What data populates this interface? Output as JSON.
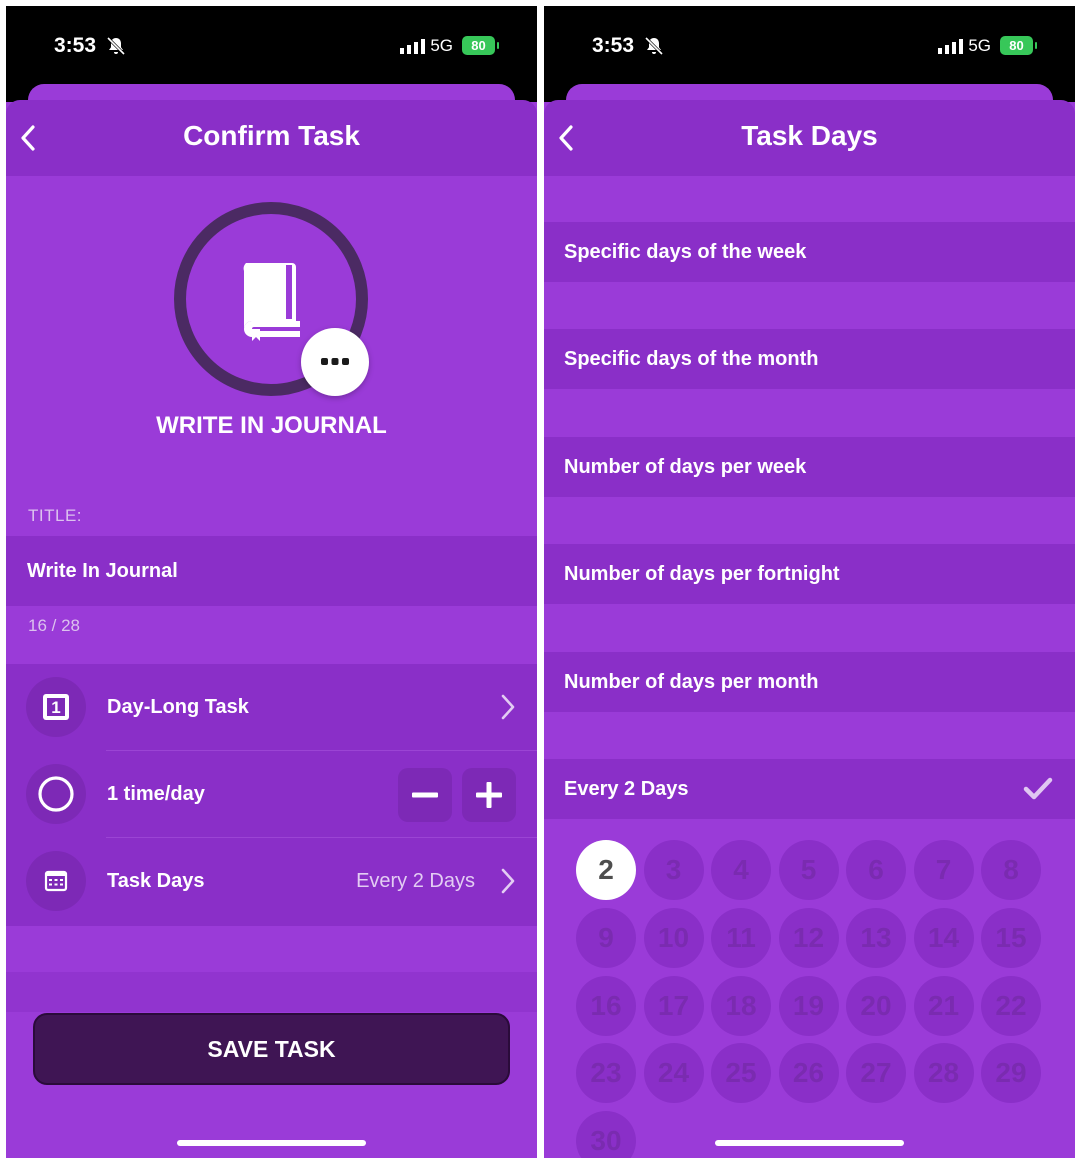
{
  "status": {
    "time": "3:53",
    "network": "5G",
    "battery": "80"
  },
  "left": {
    "header_title": "Confirm Task",
    "task_name": "WRITE IN JOURNAL",
    "title_label": "TITLE:",
    "title_value": "Write In Journal",
    "char_count": "16 / 28",
    "options": {
      "day_long": {
        "icon_text": "1",
        "label": "Day-Long Task"
      },
      "frequency": {
        "label": "1 time/day"
      },
      "task_days": {
        "label": "Task Days",
        "value": "Every 2 Days"
      }
    },
    "save_label": "SAVE TASK"
  },
  "right": {
    "header_title": "Task Days",
    "modes": [
      {
        "label": "Specific days of the week"
      },
      {
        "label": "Specific days of the month"
      },
      {
        "label": "Number of days per week"
      },
      {
        "label": "Number of days per fortnight"
      },
      {
        "label": "Number of days per month"
      },
      {
        "label": "Every 2 Days",
        "selected": true
      }
    ],
    "days": [
      "2",
      "3",
      "4",
      "5",
      "6",
      "7",
      "8",
      "9",
      "10",
      "11",
      "12",
      "13",
      "14",
      "15",
      "16",
      "17",
      "18",
      "19",
      "20",
      "21",
      "22",
      "23",
      "24",
      "25",
      "26",
      "27",
      "28",
      "29",
      "30"
    ],
    "selected_day": "2"
  },
  "colors": {
    "background": "#9a3bd8",
    "row": "#8a2fc8",
    "save_button": "#3f1554",
    "battery": "#37c759"
  }
}
